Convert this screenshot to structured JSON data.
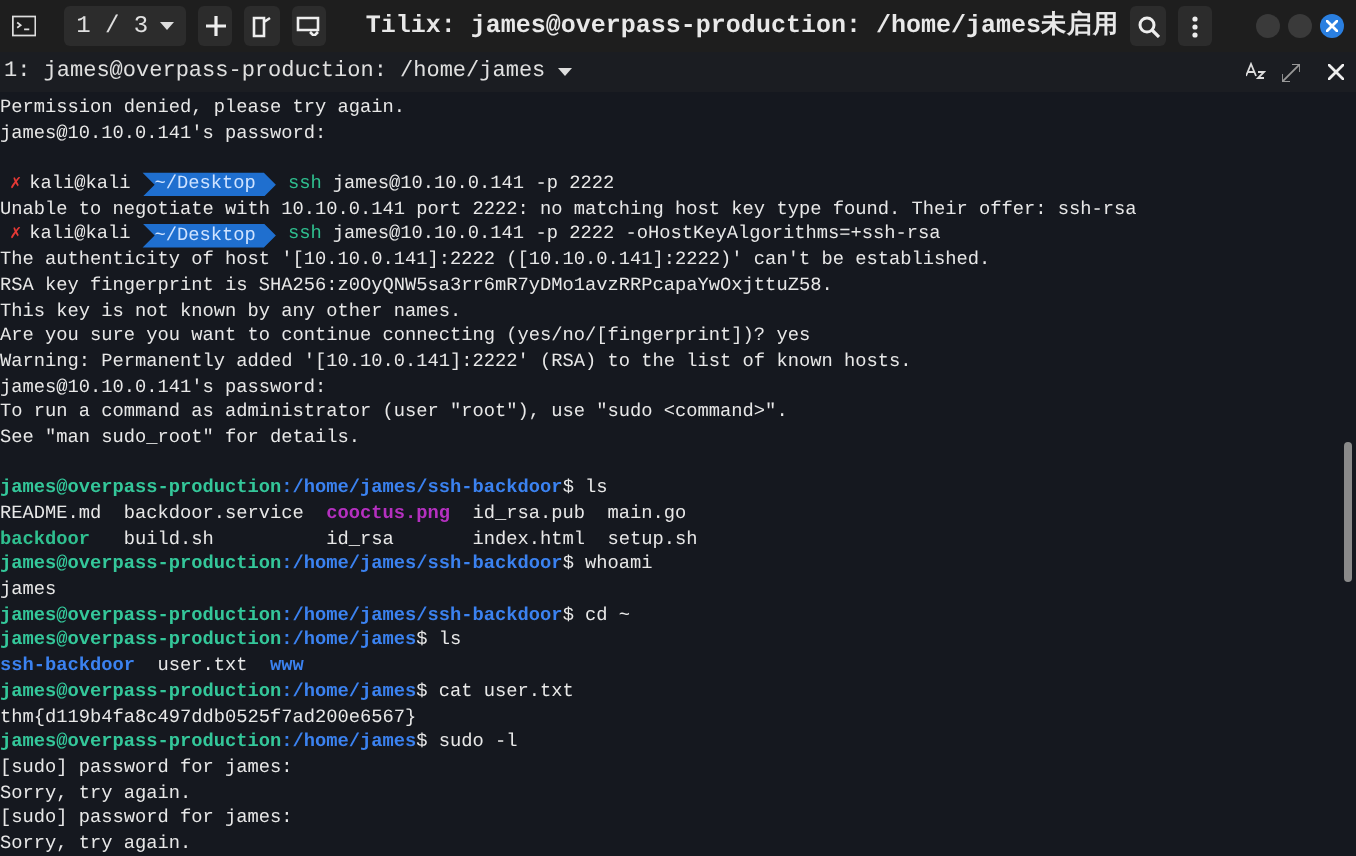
{
  "window": {
    "session_switcher": "1 / 3",
    "title": "Tilix: james@overpass-production: /home/james未启用"
  },
  "terminal_tab": {
    "title": "1: james@overpass-production: /home/james"
  },
  "lines": [
    {
      "kind": "text",
      "text": "Permission denied, please try again."
    },
    {
      "kind": "text",
      "text": "james@10.10.0.141's password:"
    },
    {
      "kind": "blank"
    },
    {
      "kind": "kali",
      "mark": "✗",
      "user": "kali@kali",
      "dir": "~/Desktop",
      "program": "ssh",
      "args": "james@10.10.0.141 -p 2222"
    },
    {
      "kind": "text",
      "text": "Unable to negotiate with 10.10.0.141 port 2222: no matching host key type found. Their offer: ssh-rsa"
    },
    {
      "kind": "kali",
      "mark": "✗",
      "user": "kali@kali",
      "dir": "~/Desktop",
      "program": "ssh",
      "args": "james@10.10.0.141 -p 2222 -oHostKeyAlgorithms=+ssh-rsa"
    },
    {
      "kind": "text",
      "text": "The authenticity of host '[10.10.0.141]:2222 ([10.10.0.141]:2222)' can't be established."
    },
    {
      "kind": "text",
      "text": "RSA key fingerprint is SHA256:z0OyQNW5sa3rr6mR7yDMo1avzRRPcapaYwOxjttuZ58."
    },
    {
      "kind": "text",
      "text": "This key is not known by any other names."
    },
    {
      "kind": "text",
      "text": "Are you sure you want to continue connecting (yes/no/[fingerprint])? yes"
    },
    {
      "kind": "text",
      "text": "Warning: Permanently added '[10.10.0.141]:2222' (RSA) to the list of known hosts."
    },
    {
      "kind": "text",
      "text": "james@10.10.0.141's password:"
    },
    {
      "kind": "text",
      "text": "To run a command as administrator (user \"root\"), use \"sudo <command>\"."
    },
    {
      "kind": "text",
      "text": "See \"man sudo_root\" for details."
    },
    {
      "kind": "blank"
    },
    {
      "kind": "prompt",
      "user": "james@overpass-production",
      "path": ":/home/james/ssh-backdoor",
      "symbol": "$",
      "command": "ls"
    },
    {
      "kind": "ls",
      "rows": [
        [
          {
            "text": "README.md",
            "color": "#e8e8e8"
          },
          {
            "text": "backdoor.service",
            "color": "#e8e8e8"
          },
          {
            "text": "cooctus.png",
            "color": "#b530c0"
          },
          {
            "text": "id_rsa.pub",
            "color": "#e8e8e8"
          },
          {
            "text": "main.go",
            "color": "#e8e8e8"
          }
        ],
        [
          {
            "text": "backdoor",
            "color": "#2fbf8f"
          },
          {
            "text": "build.sh",
            "color": "#e8e8e8"
          },
          {
            "text": "id_rsa",
            "color": "#e8e8e8"
          },
          {
            "text": "index.html",
            "color": "#e8e8e8"
          },
          {
            "text": "setup.sh",
            "color": "#e8e8e8"
          }
        ]
      ]
    },
    {
      "kind": "prompt",
      "user": "james@overpass-production",
      "path": ":/home/james/ssh-backdoor",
      "symbol": "$",
      "command": "whoami"
    },
    {
      "kind": "text",
      "text": "james"
    },
    {
      "kind": "prompt",
      "user": "james@overpass-production",
      "path": ":/home/james/ssh-backdoor",
      "symbol": "$",
      "command": "cd ~"
    },
    {
      "kind": "prompt",
      "user": "james@overpass-production",
      "path": ":/home/james",
      "symbol": "$",
      "command": "ls"
    },
    {
      "kind": "ls",
      "rows": [
        [
          {
            "text": "ssh-backdoor",
            "color": "#3b82f0"
          },
          {
            "text": "user.txt",
            "color": "#e8e8e8"
          },
          {
            "text": "www",
            "color": "#3b82f0"
          }
        ]
      ]
    },
    {
      "kind": "prompt",
      "user": "james@overpass-production",
      "path": ":/home/james",
      "symbol": "$",
      "command": "cat user.txt"
    },
    {
      "kind": "text",
      "text": "thm{d119b4fa8c497ddb0525f7ad200e6567}"
    },
    {
      "kind": "prompt",
      "user": "james@overpass-production",
      "path": ":/home/james",
      "symbol": "$",
      "command": "sudo -l"
    },
    {
      "kind": "text",
      "text": "[sudo] password for james:"
    },
    {
      "kind": "text",
      "text": "Sorry, try again."
    },
    {
      "kind": "text",
      "text": "[sudo] password for james:"
    },
    {
      "kind": "text",
      "text": "Sorry, try again."
    }
  ]
}
